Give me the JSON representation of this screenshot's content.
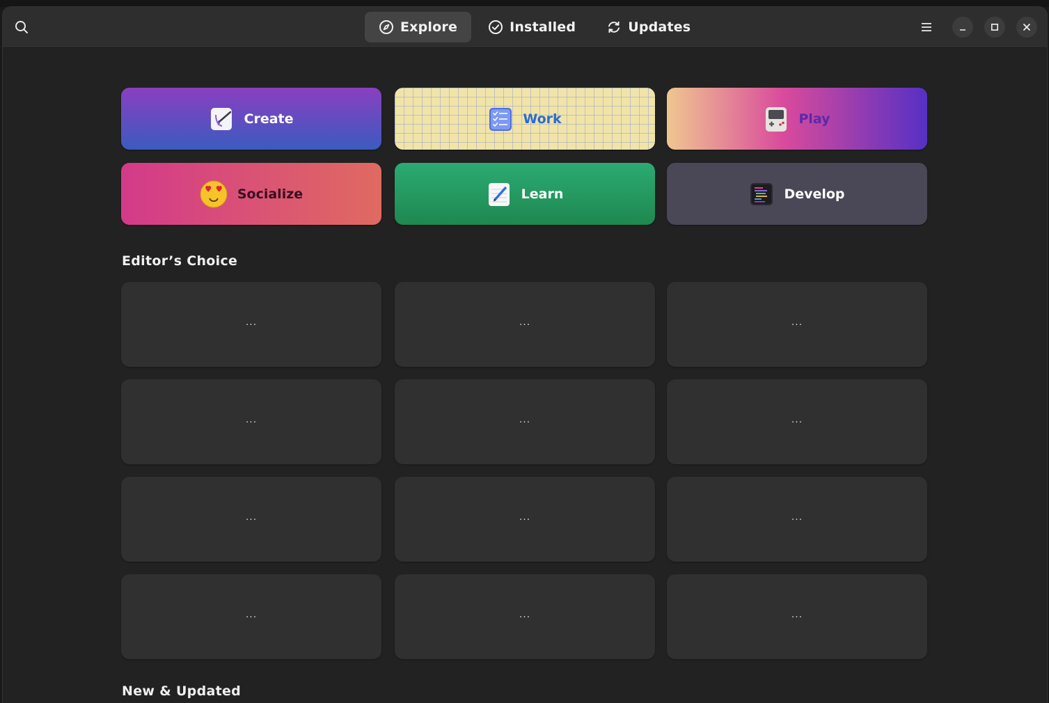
{
  "header": {
    "tabs": [
      {
        "label": "Explore",
        "icon": "compass-icon",
        "active": true
      },
      {
        "label": "Installed",
        "icon": "check-circle-icon",
        "active": false
      },
      {
        "label": "Updates",
        "icon": "refresh-icon",
        "active": false
      }
    ]
  },
  "categories": [
    {
      "label": "Create",
      "icon": "paint-brush-icon"
    },
    {
      "label": "Work",
      "icon": "checklist-icon"
    },
    {
      "label": "Play",
      "icon": "gameboy-icon"
    },
    {
      "label": "Socialize",
      "icon": "heart-eyes-emoji-icon"
    },
    {
      "label": "Learn",
      "icon": "notepad-pencil-icon"
    },
    {
      "label": "Develop",
      "icon": "code-editor-icon"
    }
  ],
  "sections": {
    "editors_choice": "Editor’s Choice",
    "new_updated": "New & Updated"
  },
  "cards": {
    "placeholder": "..."
  },
  "colors": {
    "background": "#222222",
    "headerbar": "#2e2e2e",
    "card": "#303030",
    "active_tab": "#444444"
  }
}
